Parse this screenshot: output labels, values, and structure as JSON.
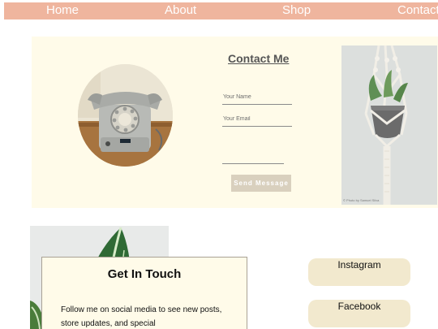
{
  "nav": {
    "items": [
      "Home",
      "About",
      "Shop",
      "Contact"
    ]
  },
  "contact": {
    "title": "Contact Me",
    "name_placeholder": "Your Name",
    "email_placeholder": "Your Email",
    "send_label": "Send Message",
    "photo_credit": "© Photo by Samuel Silva"
  },
  "touch": {
    "title": "Get In Touch",
    "text": "Follow me on social media to see new posts, store updates, and special"
  },
  "social": {
    "instagram": "Instagram",
    "facebook": "Facebook"
  },
  "colors": {
    "nav_bg": "#efb59e",
    "panel_bg": "#fffbe9",
    "social_bg": "#f2e9ce",
    "button_bg": "#d9d0be"
  }
}
